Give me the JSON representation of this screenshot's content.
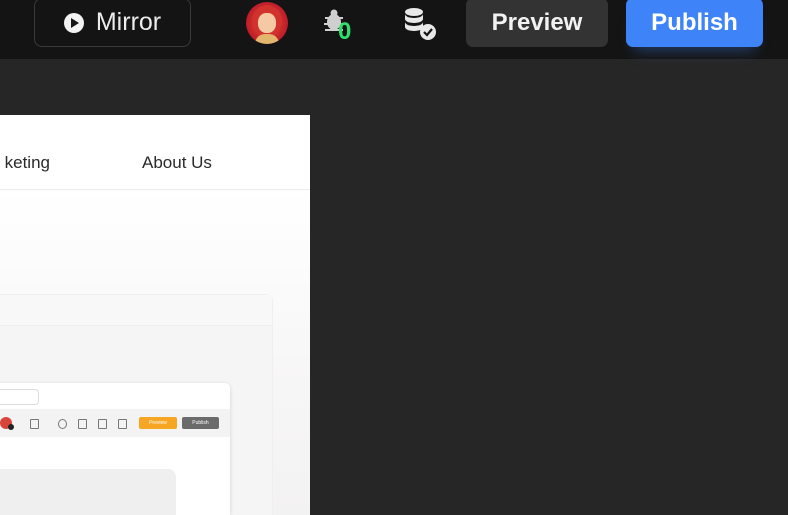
{
  "toolbar": {
    "mirror_label": "Mirror",
    "bug_count": "0",
    "preview_label": "Preview",
    "publish_label": "Publish",
    "icons": [
      "play-icon",
      "avatar",
      "bug-icon",
      "database-check-icon"
    ],
    "colors": {
      "publish": "#3f83f8",
      "preview": "#333333",
      "bug_count": "#2ee06a",
      "topbar": "#141414",
      "workspace": "#262626"
    }
  },
  "canvas": {
    "nav": {
      "marketing_partial": "keting",
      "about": "About Us"
    },
    "mini_toolbar": {
      "preview_label": "Preview",
      "publish_label": "Publish",
      "colors": {
        "preview": "#f6a623",
        "publish": "#6b6b6b"
      }
    }
  }
}
